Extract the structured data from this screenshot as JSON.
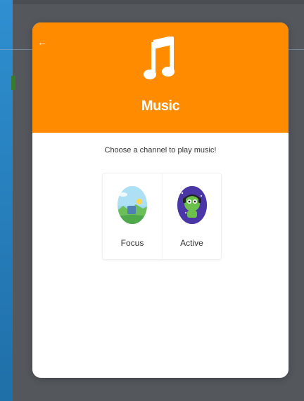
{
  "modal": {
    "back_icon": "arrow-left-icon",
    "music_icon": "music-note-icon",
    "title": "Music",
    "prompt": "Choose a channel to play music!",
    "channels": [
      {
        "label": "Focus",
        "icon": "focus-channel-icon"
      },
      {
        "label": "Active",
        "icon": "active-channel-icon"
      }
    ]
  },
  "colors": {
    "header": "#ff8c00",
    "backdrop": "#54585d",
    "left_strip": "#2e86c1"
  }
}
